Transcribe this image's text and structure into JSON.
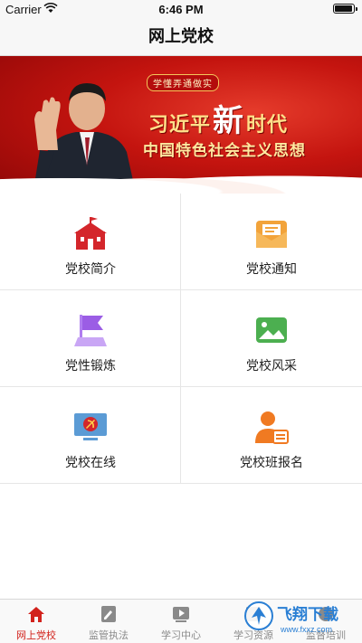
{
  "status": {
    "carrier": "Carrier",
    "time": "6:46 PM"
  },
  "nav": {
    "title": "网上党校"
  },
  "banner": {
    "top_label": "学懂弄通做实",
    "headline_pre": "习近平",
    "headline_big": "新",
    "headline_post": "时代",
    "subline": "中国特色社会主义思想"
  },
  "grid": {
    "items": [
      {
        "label": "党校简介",
        "icon": "school-building-icon"
      },
      {
        "label": "党校通知",
        "icon": "mail-envelope-icon"
      },
      {
        "label": "党性锻炼",
        "icon": "flag-icon"
      },
      {
        "label": "党校风采",
        "icon": "photo-landscape-icon"
      },
      {
        "label": "党校在线",
        "icon": "party-emblem-monitor-icon"
      },
      {
        "label": "党校班报名",
        "icon": "user-registration-icon"
      }
    ]
  },
  "tabs": [
    {
      "label": "网上党校",
      "icon": "home-icon",
      "active": true
    },
    {
      "label": "监管执法",
      "icon": "clipboard-icon",
      "active": false
    },
    {
      "label": "学习中心",
      "icon": "video-play-icon",
      "active": false
    },
    {
      "label": "学习资源",
      "icon": "book-icon",
      "active": false
    },
    {
      "label": "监督培训",
      "icon": "training-icon",
      "active": false
    }
  ],
  "watermark": {
    "text": "飞翔下载",
    "url": "www.fxxz.com"
  },
  "colors": {
    "accent": "#d2221c",
    "icon_red": "#d4262b",
    "icon_orange": "#f2a33a",
    "icon_purple": "#9b5de5",
    "icon_green": "#4caf50",
    "icon_blue": "#5b9bd5"
  }
}
